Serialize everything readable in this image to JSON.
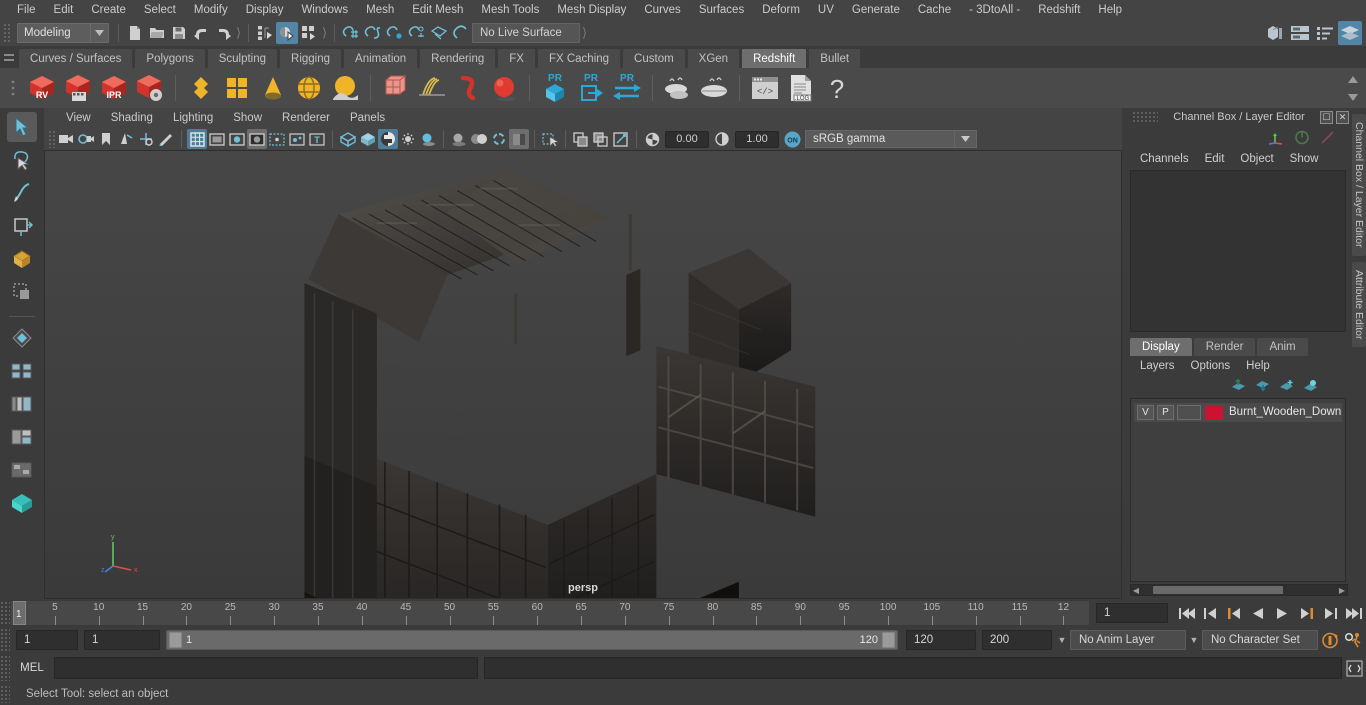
{
  "app": {
    "title": "Autodesk Maya"
  },
  "menubar": {
    "items": [
      {
        "label": "File"
      },
      {
        "label": "Edit"
      },
      {
        "label": "Create"
      },
      {
        "label": "Select"
      },
      {
        "label": "Modify"
      },
      {
        "label": "Display"
      },
      {
        "label": "Windows"
      },
      {
        "label": "Mesh"
      },
      {
        "label": "Edit Mesh"
      },
      {
        "label": "Mesh Tools"
      },
      {
        "label": "Mesh Display"
      },
      {
        "label": "Curves"
      },
      {
        "label": "Surfaces"
      },
      {
        "label": "Deform"
      },
      {
        "label": "UV"
      },
      {
        "label": "Generate"
      },
      {
        "label": "Cache"
      },
      {
        "label": "- 3DtoAll -"
      },
      {
        "label": "Redshift"
      },
      {
        "label": "Help"
      }
    ]
  },
  "statusline": {
    "menuset": "Modeling",
    "live_surface": "No Live Surface",
    "icons": [
      "new-scene-icon",
      "open-scene-icon",
      "save-scene-icon",
      "undo-icon",
      "redo-icon",
      "select-by-hierarchy-icon",
      "select-by-object-icon",
      "select-by-component-icon",
      "snap-to-grid-icon",
      "snap-to-curve-icon",
      "snap-to-point-icon",
      "snap-to-projected-center-icon",
      "snap-to-view-plane-icon",
      "make-live-icon"
    ],
    "right_icons": [
      "show-hide-modeling-toolkit-icon",
      "show-hide-attribute-editor-icon",
      "show-hide-tool-settings-icon",
      "show-hide-channel-box-icon"
    ]
  },
  "shelf": {
    "tabs": [
      {
        "label": "Curves / Surfaces",
        "active": false
      },
      {
        "label": "Polygons",
        "active": false
      },
      {
        "label": "Sculpting",
        "active": false
      },
      {
        "label": "Rigging",
        "active": false
      },
      {
        "label": "Animation",
        "active": false
      },
      {
        "label": "Rendering",
        "active": false
      },
      {
        "label": "FX",
        "active": false
      },
      {
        "label": "FX Caching",
        "active": false
      },
      {
        "label": "Custom",
        "active": false
      },
      {
        "label": "XGen",
        "active": false
      },
      {
        "label": "Redshift",
        "active": true
      },
      {
        "label": "Bullet",
        "active": false
      }
    ],
    "buttons": [
      {
        "name": "redshift-render-view-icon",
        "badge": "RV"
      },
      {
        "name": "redshift-render-sequence-icon",
        "badge": "film"
      },
      {
        "name": "redshift-ipr-icon",
        "badge": "IPR"
      },
      {
        "name": "redshift-render-settings-icon",
        "badge": "gear"
      },
      {
        "name": "redshift-material-icon",
        "badge": ""
      },
      {
        "name": "redshift-material-blender-icon",
        "badge": ""
      },
      {
        "name": "redshift-sss-icon",
        "badge": ""
      },
      {
        "name": "redshift-dome-light-icon",
        "badge": ""
      },
      {
        "name": "redshift-environment-icon",
        "badge": ""
      },
      {
        "name": "redshift-volume-icon",
        "badge": ""
      },
      {
        "name": "redshift-hair-icon",
        "badge": ""
      },
      {
        "name": "redshift-curve-icon",
        "badge": ""
      },
      {
        "name": "redshift-sphere-icon",
        "badge": ""
      },
      {
        "name": "redshift-proxy-export-icon",
        "badge": "PR"
      },
      {
        "name": "redshift-proxy-import-icon",
        "badge": "PR"
      },
      {
        "name": "redshift-proxy-swap-icon",
        "badge": "PR"
      },
      {
        "name": "redshift-bake-icon",
        "badge": ""
      },
      {
        "name": "redshift-bake-all-icon",
        "badge": ""
      },
      {
        "name": "redshift-script-icon",
        "badge": ""
      },
      {
        "name": "redshift-log-icon",
        "badge": ".LOG"
      },
      {
        "name": "redshift-help-icon",
        "badge": "?"
      }
    ]
  },
  "toolbox": {
    "items": [
      {
        "name": "select-tool",
        "selected": true
      },
      {
        "name": "lasso-select-tool",
        "selected": false
      },
      {
        "name": "paint-select-tool",
        "selected": false
      },
      {
        "name": "move-tool",
        "selected": false
      },
      {
        "name": "rotate-tool",
        "selected": false
      },
      {
        "name": "scale-tool",
        "selected": false
      },
      {
        "name": "last-tool-used",
        "selected": false
      },
      {
        "name": "layout-four-view",
        "selected": false
      },
      {
        "name": "layout-persp-outliner",
        "selected": false
      },
      {
        "name": "layout-persp-graph",
        "selected": false
      },
      {
        "name": "layout-hypershade",
        "selected": false
      },
      {
        "name": "layout-single-persp",
        "selected": false
      }
    ]
  },
  "viewport": {
    "panel_menus": [
      {
        "label": "View"
      },
      {
        "label": "Shading"
      },
      {
        "label": "Lighting"
      },
      {
        "label": "Show"
      },
      {
        "label": "Renderer"
      },
      {
        "label": "Panels"
      }
    ],
    "camera_label": "persp",
    "exposure": "0.00",
    "gamma": "1.00",
    "color_toggle": "ON",
    "color_profile": "sRGB gamma",
    "toolbar_icons": [
      "select-camera-icon",
      "camera-attributes-icon",
      "bookmarks-icon",
      "image-plane-icon",
      "2d-pan-zoom-icon",
      "grease-pencil-icon",
      "grid-toggle-icon",
      "film-gate-icon",
      "resolution-gate-icon",
      "gate-mask-icon",
      "film-origin-icon",
      "xray-joints-icon",
      "xray-icon",
      "wireframe-icon",
      "smooth-shade-icon",
      "textured-icon",
      "use-default-light-icon",
      "shadows-icon",
      "screen-space-ao-icon",
      "motion-blur-icon",
      "multisample-aa-icon",
      "depth-of-field-icon",
      "isolate-select-icon",
      "xray-display-icon",
      "xray-active-components-icon",
      "xray-joints-display-icon",
      "exposure-icon",
      "gamma-icon"
    ],
    "axis_labels": {
      "x": "x",
      "y": "y",
      "z": "z"
    }
  },
  "channelbox": {
    "title": "Channel Box / Layer Editor",
    "menus": [
      {
        "label": "Channels"
      },
      {
        "label": "Edit"
      },
      {
        "label": "Object"
      },
      {
        "label": "Show"
      }
    ],
    "header_icons": [
      "transform-channels-icon",
      "output-channels-icon",
      "shape-channels-icon"
    ],
    "window_buttons": [
      "restore-icon",
      "close-icon"
    ],
    "side_tabs": [
      "Channel Box / Layer Editor",
      "Attribute Editor"
    ]
  },
  "layer_editor": {
    "tabs": [
      {
        "label": "Display",
        "active": true
      },
      {
        "label": "Render",
        "active": false
      },
      {
        "label": "Anim",
        "active": false
      }
    ],
    "menus": [
      {
        "label": "Layers"
      },
      {
        "label": "Options"
      },
      {
        "label": "Help"
      }
    ],
    "toolbar_icons": [
      "move-layer-up-icon",
      "move-layer-down-icon",
      "new-layer-icon",
      "new-layer-from-selected-icon"
    ],
    "layers": [
      {
        "visibility": "V",
        "playback": "P",
        "type": "",
        "color": "#cc1133",
        "name": "Burnt_Wooden_Down"
      }
    ]
  },
  "timeline": {
    "start": 1,
    "end": 120,
    "current_frame": "1",
    "tick_labels": [
      "5",
      "10",
      "15",
      "20",
      "25",
      "30",
      "35",
      "40",
      "45",
      "50",
      "55",
      "60",
      "65",
      "70",
      "75",
      "80",
      "85",
      "90",
      "95",
      "100",
      "105",
      "110",
      "115",
      "12"
    ],
    "playback_buttons": [
      "go-to-start-icon",
      "step-back-keyframe-icon",
      "step-back-frame-icon",
      "play-backwards-icon",
      "play-forwards-icon",
      "step-forward-frame-icon",
      "step-forward-keyframe-icon",
      "go-to-end-icon"
    ]
  },
  "rangeslider": {
    "anim_start": "1",
    "range_start": "1",
    "slider_start": "1",
    "slider_end": "120",
    "range_end": "120",
    "anim_end": "200",
    "anim_layer": "No Anim Layer",
    "character_set": "No Character Set",
    "right_icons": [
      "auto-keyframe-icon",
      "animation-preferences-icon"
    ]
  },
  "commandline": {
    "language_label": "MEL",
    "input_value": "",
    "output_value": "",
    "script_editor_icon": "script-editor-icon"
  },
  "helpline": {
    "message": "Select Tool: select an object"
  },
  "colors": {
    "accent_blue": "#5285a6",
    "layer_red": "#cc1133",
    "orange": "#e07b28",
    "shelf_red": "#d0342c",
    "shelf_yellow": "#f0b429",
    "cyan": "#2aa9d8"
  }
}
